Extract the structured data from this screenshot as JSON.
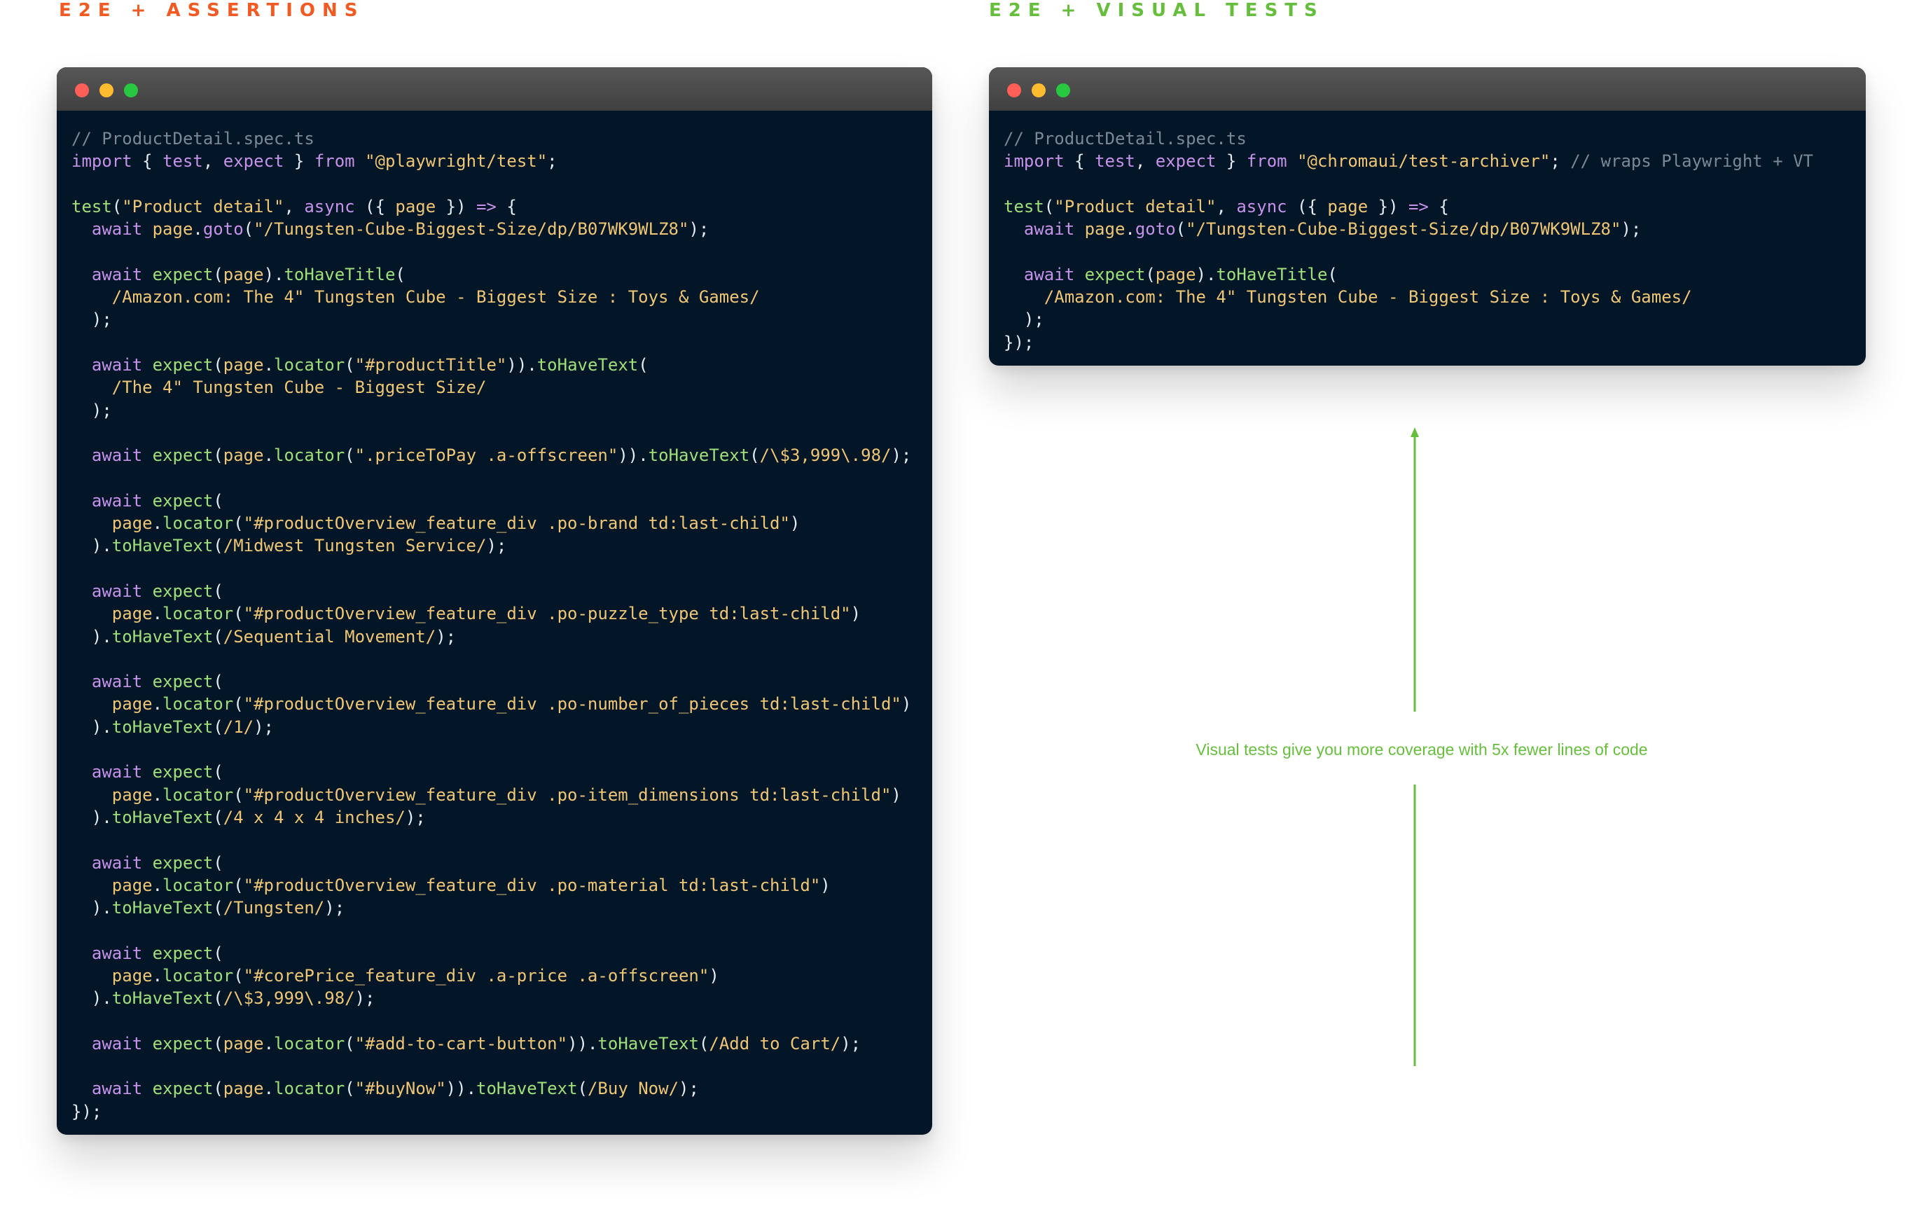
{
  "headings": {
    "left": "E2E + ASSERTIONS",
    "right": "E2E + VISUAL TESTS"
  },
  "colors": {
    "left_heading": "#f15a22",
    "right_heading": "#66bf3c",
    "editor_background": "#021628",
    "titlebar": "#4a4a4a",
    "dot_red": "#fe5f57",
    "dot_yellow": "#febc2e",
    "dot_green": "#28c840",
    "comment": "#7a8996",
    "keyword": "#c792ea",
    "function": "#9ee07a",
    "string": "#f0c674",
    "plain": "#e6edf3",
    "annotation": "#66bf3c"
  },
  "window_controls": [
    "close-dot",
    "minimize-dot",
    "maximize-dot"
  ],
  "left_editor": {
    "lines": [
      [
        [
          "comment",
          "// ProductDetail.spec.ts"
        ]
      ],
      [
        [
          "keyword",
          "import"
        ],
        [
          "plain",
          " { "
        ],
        [
          "keyword",
          "test"
        ],
        [
          "plain",
          ", "
        ],
        [
          "keyword",
          "expect"
        ],
        [
          "plain",
          " } "
        ],
        [
          "keyword",
          "from"
        ],
        [
          "plain",
          " "
        ],
        [
          "string",
          "\"@playwright/test\""
        ],
        [
          "plain",
          ";"
        ]
      ],
      [],
      [
        [
          "func",
          "test"
        ],
        [
          "plain",
          "("
        ],
        [
          "string",
          "\"Product detail\""
        ],
        [
          "plain",
          ", "
        ],
        [
          "keyword",
          "async"
        ],
        [
          "plain",
          " ({ "
        ],
        [
          "string",
          "page"
        ],
        [
          "plain",
          " }) "
        ],
        [
          "keyword",
          "=>"
        ],
        [
          "plain",
          " {"
        ]
      ],
      [
        [
          "plain",
          "  "
        ],
        [
          "keyword",
          "await"
        ],
        [
          "plain",
          " "
        ],
        [
          "string",
          "page"
        ],
        [
          "plain",
          "."
        ],
        [
          "keyword",
          "goto"
        ],
        [
          "plain",
          "("
        ],
        [
          "string",
          "\"/Tungsten-Cube-Biggest-Size/dp/B07WK9WLZ8\""
        ],
        [
          "plain",
          ");"
        ]
      ],
      [],
      [
        [
          "plain",
          "  "
        ],
        [
          "keyword",
          "await"
        ],
        [
          "plain",
          " "
        ],
        [
          "func",
          "expect"
        ],
        [
          "plain",
          "("
        ],
        [
          "string",
          "page"
        ],
        [
          "plain",
          ")."
        ],
        [
          "func",
          "toHaveTitle"
        ],
        [
          "plain",
          "("
        ]
      ],
      [
        [
          "plain",
          "    "
        ],
        [
          "string",
          "/Amazon.com: The 4\" Tungsten Cube - Biggest Size : Toys & Games/"
        ]
      ],
      [
        [
          "plain",
          "  );"
        ]
      ],
      [],
      [
        [
          "plain",
          "  "
        ],
        [
          "keyword",
          "await"
        ],
        [
          "plain",
          " "
        ],
        [
          "func",
          "expect"
        ],
        [
          "plain",
          "("
        ],
        [
          "string",
          "page"
        ],
        [
          "plain",
          "."
        ],
        [
          "func",
          "locator"
        ],
        [
          "plain",
          "("
        ],
        [
          "string",
          "\"#productTitle\""
        ],
        [
          "plain",
          "))."
        ],
        [
          "func",
          "toHaveText"
        ],
        [
          "plain",
          "("
        ]
      ],
      [
        [
          "plain",
          "    "
        ],
        [
          "string",
          "/The 4\" Tungsten Cube - Biggest Size/"
        ]
      ],
      [
        [
          "plain",
          "  );"
        ]
      ],
      [],
      [
        [
          "plain",
          "  "
        ],
        [
          "keyword",
          "await"
        ],
        [
          "plain",
          " "
        ],
        [
          "func",
          "expect"
        ],
        [
          "plain",
          "("
        ],
        [
          "string",
          "page"
        ],
        [
          "plain",
          "."
        ],
        [
          "func",
          "locator"
        ],
        [
          "plain",
          "("
        ],
        [
          "string",
          "\".priceToPay .a-offscreen\""
        ],
        [
          "plain",
          "))."
        ],
        [
          "func",
          "toHaveText"
        ],
        [
          "plain",
          "("
        ],
        [
          "string",
          "/\\$3,999\\.98/"
        ],
        [
          "plain",
          ");"
        ]
      ],
      [],
      [
        [
          "plain",
          "  "
        ],
        [
          "keyword",
          "await"
        ],
        [
          "plain",
          " "
        ],
        [
          "func",
          "expect"
        ],
        [
          "plain",
          "("
        ]
      ],
      [
        [
          "plain",
          "    "
        ],
        [
          "string",
          "page"
        ],
        [
          "plain",
          "."
        ],
        [
          "func",
          "locator"
        ],
        [
          "plain",
          "("
        ],
        [
          "string",
          "\"#productOverview_feature_div .po-brand td:last-child\""
        ],
        [
          "plain",
          ")"
        ]
      ],
      [
        [
          "plain",
          "  )."
        ],
        [
          "func",
          "toHaveText"
        ],
        [
          "plain",
          "("
        ],
        [
          "string",
          "/Midwest Tungsten Service/"
        ],
        [
          "plain",
          ");"
        ]
      ],
      [],
      [
        [
          "plain",
          "  "
        ],
        [
          "keyword",
          "await"
        ],
        [
          "plain",
          " "
        ],
        [
          "func",
          "expect"
        ],
        [
          "plain",
          "("
        ]
      ],
      [
        [
          "plain",
          "    "
        ],
        [
          "string",
          "page"
        ],
        [
          "plain",
          "."
        ],
        [
          "func",
          "locator"
        ],
        [
          "plain",
          "("
        ],
        [
          "string",
          "\"#productOverview_feature_div .po-puzzle_type td:last-child\""
        ],
        [
          "plain",
          ")"
        ]
      ],
      [
        [
          "plain",
          "  )."
        ],
        [
          "func",
          "toHaveText"
        ],
        [
          "plain",
          "("
        ],
        [
          "string",
          "/Sequential Movement/"
        ],
        [
          "plain",
          ");"
        ]
      ],
      [],
      [
        [
          "plain",
          "  "
        ],
        [
          "keyword",
          "await"
        ],
        [
          "plain",
          " "
        ],
        [
          "func",
          "expect"
        ],
        [
          "plain",
          "("
        ]
      ],
      [
        [
          "plain",
          "    "
        ],
        [
          "string",
          "page"
        ],
        [
          "plain",
          "."
        ],
        [
          "func",
          "locator"
        ],
        [
          "plain",
          "("
        ],
        [
          "string",
          "\"#productOverview_feature_div .po-number_of_pieces td:last-child\""
        ],
        [
          "plain",
          ")"
        ]
      ],
      [
        [
          "plain",
          "  )."
        ],
        [
          "func",
          "toHaveText"
        ],
        [
          "plain",
          "("
        ],
        [
          "string",
          "/1/"
        ],
        [
          "plain",
          ");"
        ]
      ],
      [],
      [
        [
          "plain",
          "  "
        ],
        [
          "keyword",
          "await"
        ],
        [
          "plain",
          " "
        ],
        [
          "func",
          "expect"
        ],
        [
          "plain",
          "("
        ]
      ],
      [
        [
          "plain",
          "    "
        ],
        [
          "string",
          "page"
        ],
        [
          "plain",
          "."
        ],
        [
          "func",
          "locator"
        ],
        [
          "plain",
          "("
        ],
        [
          "string",
          "\"#productOverview_feature_div .po-item_dimensions td:last-child\""
        ],
        [
          "plain",
          ")"
        ]
      ],
      [
        [
          "plain",
          "  )."
        ],
        [
          "func",
          "toHaveText"
        ],
        [
          "plain",
          "("
        ],
        [
          "string",
          "/4 x 4 x 4 inches/"
        ],
        [
          "plain",
          ");"
        ]
      ],
      [],
      [
        [
          "plain",
          "  "
        ],
        [
          "keyword",
          "await"
        ],
        [
          "plain",
          " "
        ],
        [
          "func",
          "expect"
        ],
        [
          "plain",
          "("
        ]
      ],
      [
        [
          "plain",
          "    "
        ],
        [
          "string",
          "page"
        ],
        [
          "plain",
          "."
        ],
        [
          "func",
          "locator"
        ],
        [
          "plain",
          "("
        ],
        [
          "string",
          "\"#productOverview_feature_div .po-material td:last-child\""
        ],
        [
          "plain",
          ")"
        ]
      ],
      [
        [
          "plain",
          "  )."
        ],
        [
          "func",
          "toHaveText"
        ],
        [
          "plain",
          "("
        ],
        [
          "string",
          "/Tungsten/"
        ],
        [
          "plain",
          ");"
        ]
      ],
      [],
      [
        [
          "plain",
          "  "
        ],
        [
          "keyword",
          "await"
        ],
        [
          "plain",
          " "
        ],
        [
          "func",
          "expect"
        ],
        [
          "plain",
          "("
        ]
      ],
      [
        [
          "plain",
          "    "
        ],
        [
          "string",
          "page"
        ],
        [
          "plain",
          "."
        ],
        [
          "func",
          "locator"
        ],
        [
          "plain",
          "("
        ],
        [
          "string",
          "\"#corePrice_feature_div .a-price .a-offscreen\""
        ],
        [
          "plain",
          ")"
        ]
      ],
      [
        [
          "plain",
          "  )."
        ],
        [
          "func",
          "toHaveText"
        ],
        [
          "plain",
          "("
        ],
        [
          "string",
          "/\\$3,999\\.98/"
        ],
        [
          "plain",
          ");"
        ]
      ],
      [],
      [
        [
          "plain",
          "  "
        ],
        [
          "keyword",
          "await"
        ],
        [
          "plain",
          " "
        ],
        [
          "func",
          "expect"
        ],
        [
          "plain",
          "("
        ],
        [
          "string",
          "page"
        ],
        [
          "plain",
          "."
        ],
        [
          "func",
          "locator"
        ],
        [
          "plain",
          "("
        ],
        [
          "string",
          "\"#add-to-cart-button\""
        ],
        [
          "plain",
          "))."
        ],
        [
          "func",
          "toHaveText"
        ],
        [
          "plain",
          "("
        ],
        [
          "string",
          "/Add to Cart/"
        ],
        [
          "plain",
          ");"
        ]
      ],
      [],
      [
        [
          "plain",
          "  "
        ],
        [
          "keyword",
          "await"
        ],
        [
          "plain",
          " "
        ],
        [
          "func",
          "expect"
        ],
        [
          "plain",
          "("
        ],
        [
          "string",
          "page"
        ],
        [
          "plain",
          "."
        ],
        [
          "func",
          "locator"
        ],
        [
          "plain",
          "("
        ],
        [
          "string",
          "\"#buyNow\""
        ],
        [
          "plain",
          "))."
        ],
        [
          "func",
          "toHaveText"
        ],
        [
          "plain",
          "("
        ],
        [
          "string",
          "/Buy Now/"
        ],
        [
          "plain",
          ");"
        ]
      ],
      [
        [
          "plain",
          "});"
        ]
      ]
    ]
  },
  "right_editor": {
    "lines": [
      [
        [
          "comment",
          "// ProductDetail.spec.ts"
        ]
      ],
      [
        [
          "keyword",
          "import"
        ],
        [
          "plain",
          " { "
        ],
        [
          "keyword",
          "test"
        ],
        [
          "plain",
          ", "
        ],
        [
          "keyword",
          "expect"
        ],
        [
          "plain",
          " } "
        ],
        [
          "keyword",
          "from"
        ],
        [
          "plain",
          " "
        ],
        [
          "string",
          "\"@chromaui/test-archiver\""
        ],
        [
          "plain",
          "; "
        ],
        [
          "comment",
          "// wraps Playwright + VT"
        ]
      ],
      [],
      [
        [
          "func",
          "test"
        ],
        [
          "plain",
          "("
        ],
        [
          "string",
          "\"Product detail\""
        ],
        [
          "plain",
          ", "
        ],
        [
          "keyword",
          "async"
        ],
        [
          "plain",
          " ({ "
        ],
        [
          "string",
          "page"
        ],
        [
          "plain",
          " }) "
        ],
        [
          "keyword",
          "=>"
        ],
        [
          "plain",
          " {"
        ]
      ],
      [
        [
          "plain",
          "  "
        ],
        [
          "keyword",
          "await"
        ],
        [
          "plain",
          " "
        ],
        [
          "string",
          "page"
        ],
        [
          "plain",
          "."
        ],
        [
          "keyword",
          "goto"
        ],
        [
          "plain",
          "("
        ],
        [
          "string",
          "\"/Tungsten-Cube-Biggest-Size/dp/B07WK9WLZ8\""
        ],
        [
          "plain",
          ");"
        ]
      ],
      [],
      [
        [
          "plain",
          "  "
        ],
        [
          "keyword",
          "await"
        ],
        [
          "plain",
          " "
        ],
        [
          "func",
          "expect"
        ],
        [
          "plain",
          "("
        ],
        [
          "string",
          "page"
        ],
        [
          "plain",
          ")."
        ],
        [
          "func",
          "toHaveTitle"
        ],
        [
          "plain",
          "("
        ]
      ],
      [
        [
          "plain",
          "    "
        ],
        [
          "string",
          "/Amazon.com: The 4\" Tungsten Cube - Biggest Size : Toys & Games/"
        ]
      ],
      [
        [
          "plain",
          "  );"
        ]
      ],
      [
        [
          "plain",
          "});"
        ]
      ]
    ]
  },
  "annotation": {
    "caption": "Visual tests give you more coverage with 5x fewer lines of code",
    "arrow_direction": "up"
  }
}
